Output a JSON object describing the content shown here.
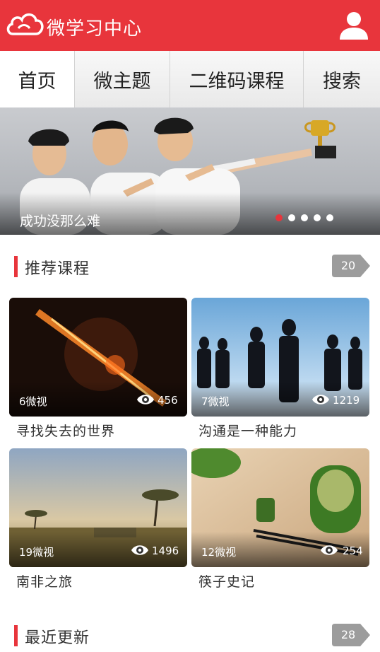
{
  "header": {
    "title": "微学习中心",
    "logo_icon": "cloud-logo-icon",
    "user_icon": "user-icon",
    "brand_color": "#e8353c"
  },
  "tabs": [
    {
      "label": "首页",
      "active": true
    },
    {
      "label": "微主题",
      "active": false
    },
    {
      "label": "二维码课程",
      "active": false
    },
    {
      "label": "搜索",
      "active": false
    }
  ],
  "banner": {
    "caption": "成功没那么难",
    "slide_count": 5,
    "active_slide": 1
  },
  "recommended": {
    "title": "推荐课程",
    "count": "20",
    "courses": [
      {
        "count_label": "6微视",
        "views": "456",
        "title": "寻找失去的世界"
      },
      {
        "count_label": "7微视",
        "views": "1219",
        "title": "沟通是一种能力"
      },
      {
        "count_label": "19微视",
        "views": "1496",
        "title": "南非之旅"
      },
      {
        "count_label": "12微视",
        "views": "254",
        "title": "筷子史记"
      }
    ]
  },
  "recent": {
    "title": "最近更新",
    "count": "28"
  }
}
